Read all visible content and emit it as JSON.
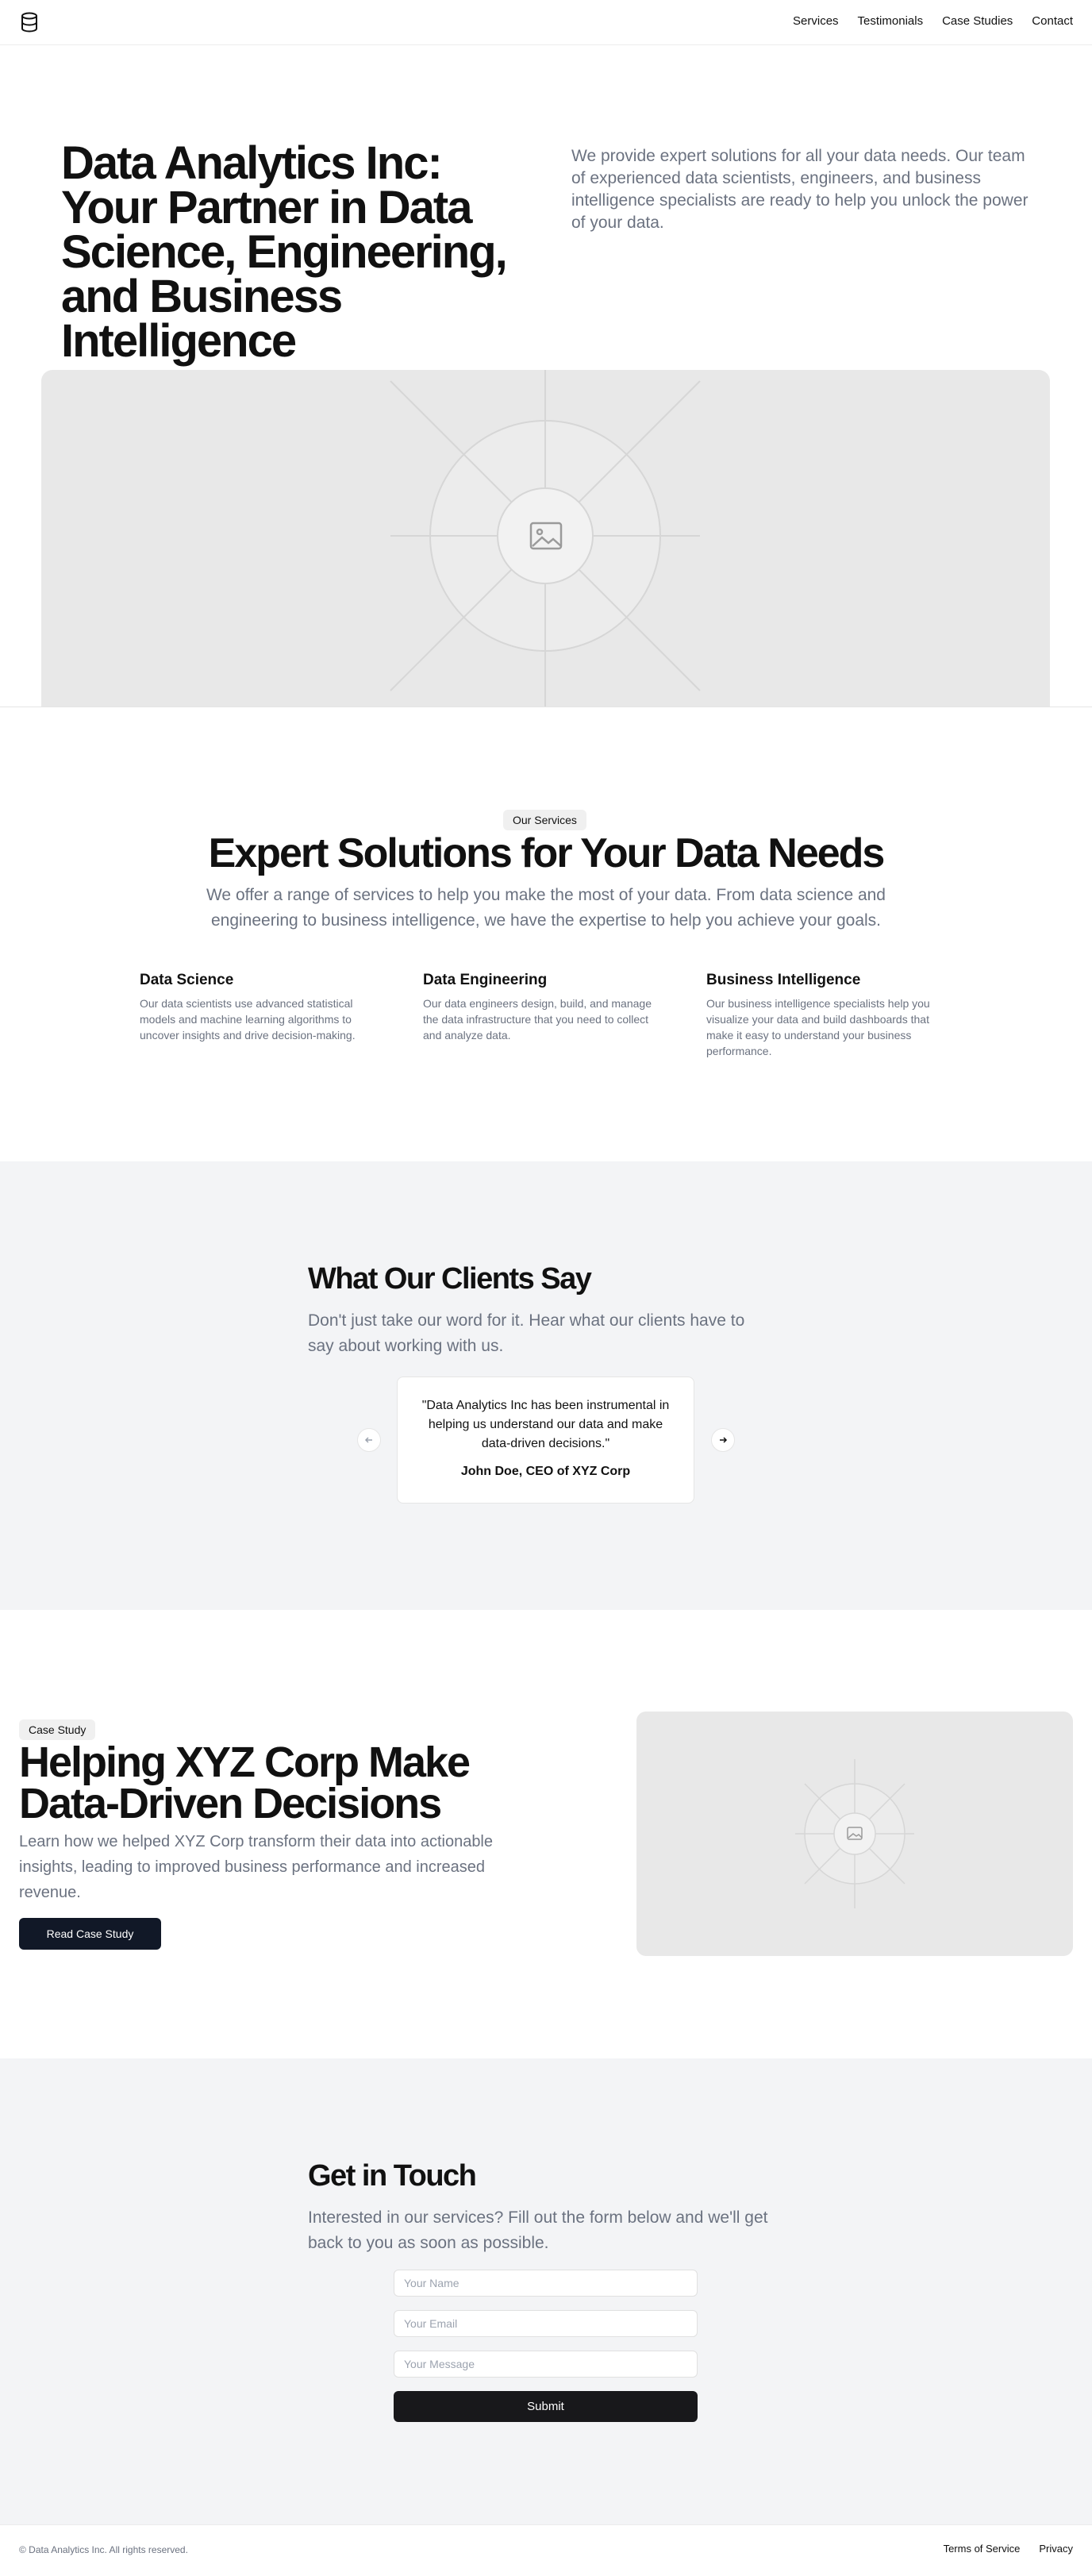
{
  "header": {
    "nav": [
      "Services",
      "Testimonials",
      "Case Studies",
      "Contact"
    ],
    "logo_icon": "database-icon"
  },
  "hero": {
    "title": "Data Analytics Inc: Your Partner in Data Science, Engineering, and Business Intelligence",
    "description": "We provide expert solutions for all your data needs. Our team of experienced data scientists, engineers, and business intelligence specialists are ready to help you unlock the power of your data.",
    "image_icon": "image-placeholder-icon"
  },
  "services": {
    "badge": "Our Services",
    "title": "Expert Solutions for Your Data Needs",
    "subtitle": "We offer a range of services to help you make the most of your data. From data science and engineering to business intelligence, we have the expertise to help you achieve your goals.",
    "items": [
      {
        "title": "Data Science",
        "text": "Our data scientists use advanced statistical models and machine learning algorithms to uncover insights and drive decision-making."
      },
      {
        "title": "Data Engineering",
        "text": "Our data engineers design, build, and manage the data infrastructure that you need to collect and analyze data."
      },
      {
        "title": "Business Intelligence",
        "text": "Our business intelligence specialists help you visualize your data and build dashboards that make it easy to understand your business performance."
      }
    ]
  },
  "testimonials": {
    "title": "What Our Clients Say",
    "subtitle": "Don't just take our word for it. Hear what our clients have to say about working with us.",
    "quote": "\"Data Analytics Inc has been instrumental in helping us understand our data and make data-driven decisions.\"",
    "author": "John Doe, CEO of XYZ Corp",
    "prev_icon": "arrow-left-icon",
    "next_icon": "arrow-right-icon"
  },
  "case_study": {
    "badge": "Case Study",
    "title": "Helping XYZ Corp Make Data-Driven Decisions",
    "description": "Learn how we helped XYZ Corp transform their data into actionable insights, leading to improved business performance and increased revenue.",
    "button": "Read Case Study"
  },
  "contact": {
    "title": "Get in Touch",
    "subtitle": "Interested in our services? Fill out the form below and we'll get back to you as soon as possible.",
    "name_placeholder": "Your Name",
    "email_placeholder": "Your Email",
    "message_placeholder": "Your Message",
    "submit": "Submit"
  },
  "footer": {
    "copyright": "© Data Analytics Inc. All rights reserved.",
    "links": [
      "Terms of Service",
      "Privacy"
    ]
  }
}
